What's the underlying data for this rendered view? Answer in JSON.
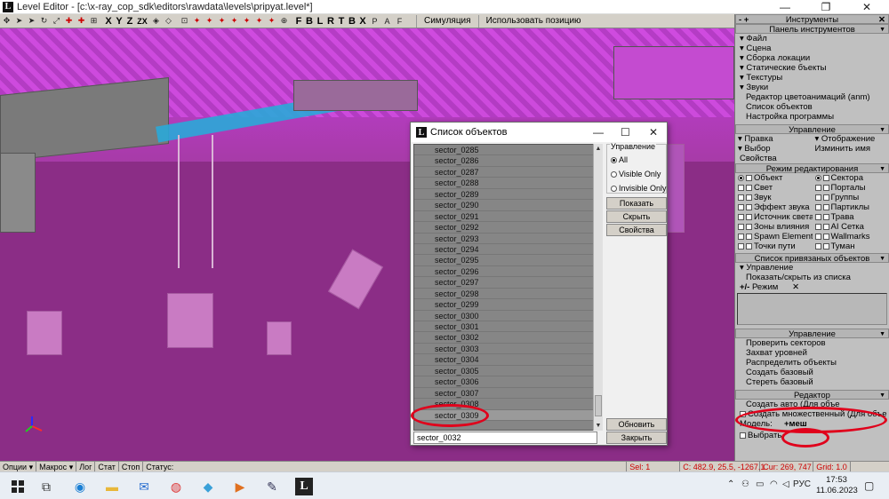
{
  "window": {
    "title": "Level Editor - [c:\\x-ray_cop_sdk\\editors\\rawdata\\levels\\pripyat.level*]",
    "min": "—",
    "max": "❐",
    "close": "✕"
  },
  "toolbar": {
    "letters": [
      "X",
      "Y",
      "Z",
      "ZX"
    ],
    "letters2": [
      "F",
      "B",
      "L",
      "R",
      "T",
      "B",
      "X"
    ],
    "sim_label": "Симуляция",
    "use_pos_label": "Использовать позицию"
  },
  "statusbar": {
    "options": "Опции",
    "macros": "Макрос",
    "log": "Лог",
    "stat": "Стат",
    "stop": "Стоп",
    "status": "Статус:",
    "sel": "Sel: 1",
    "coords": "C: 482.9, 25.5, -1267.1",
    "cur": "Cur: 269, 747",
    "grid": "Grid: 1.0"
  },
  "panel": {
    "tools_header": "Инструменты",
    "toolbar_header": "Панель инструментов",
    "tools_items": [
      "Файл",
      "Сцена",
      "Сборка локации",
      "Статические бъекты",
      "Текстуры",
      "Звуки"
    ],
    "tools_links": [
      "Редактор цветоанимаций (anm)",
      "Список объектов",
      "Настройка программы"
    ],
    "control_header": "Управление",
    "edit_label": "Правка",
    "display_label": "Отображение",
    "select_label": "Выбор",
    "rename_label": "Изминить имя",
    "props_label": "Свойства",
    "edit_mode_header": "Режим редактирования",
    "modes_left": [
      "Объект",
      "Свет",
      "Звук",
      "Эффект звука",
      "Источник света",
      "Зоны влияния",
      "Spawn Element",
      "Точки пути"
    ],
    "modes_right": [
      "Сектора",
      "Порталы",
      "Группы",
      "Партиклы",
      "Трава",
      "AI Сетка",
      "Wallmarks",
      "Туман"
    ],
    "attached_header": "Список привязаных объектов",
    "attached_control": "Управление",
    "attached_toggle": "Показать/скрыть из списка",
    "attached_mode": "Режим",
    "control2_header": "Управление",
    "control2_items": [
      "Проверить секторов",
      "Захват уровней",
      "Распределить объекты",
      "Создать базовый",
      "Стереть базовый"
    ],
    "editor_header": "Редактор",
    "editor_create_auto": "Создать авто (Для объе",
    "editor_create_multi": "Создать множественный (Для объе",
    "editor_model": "Модель:",
    "editor_mesh": "+меш",
    "editor_select": "Выбрать"
  },
  "dialog": {
    "title": "Список объектов",
    "items": [
      "sector_0285",
      "sector_0286",
      "sector_0287",
      "sector_0288",
      "sector_0289",
      "sector_0290",
      "sector_0291",
      "sector_0292",
      "sector_0293",
      "sector_0294",
      "sector_0295",
      "sector_0296",
      "sector_0297",
      "sector_0298",
      "sector_0299",
      "sector_0300",
      "sector_0301",
      "sector_0302",
      "sector_0303",
      "sector_0304",
      "sector_0305",
      "sector_0306",
      "sector_0307",
      "sector_0308",
      "sector_0309"
    ],
    "selected_index": 24,
    "search_value": "sector_0032",
    "group_title": "Управление",
    "opt_all": "All",
    "opt_visible": "Visible Only",
    "opt_invisible": "Invisible Only",
    "btn_show": "Показать",
    "btn_hide": "Скрыть",
    "btn_props": "Свойства",
    "btn_refresh": "Обновить список",
    "btn_close": "Закрыть"
  },
  "taskbar": {
    "lang": "РУС",
    "time": "17:53",
    "date": "11.06.2023"
  },
  "colors": {
    "annotation": "#e0001b",
    "viewport_magenta": "#b43cc0"
  }
}
